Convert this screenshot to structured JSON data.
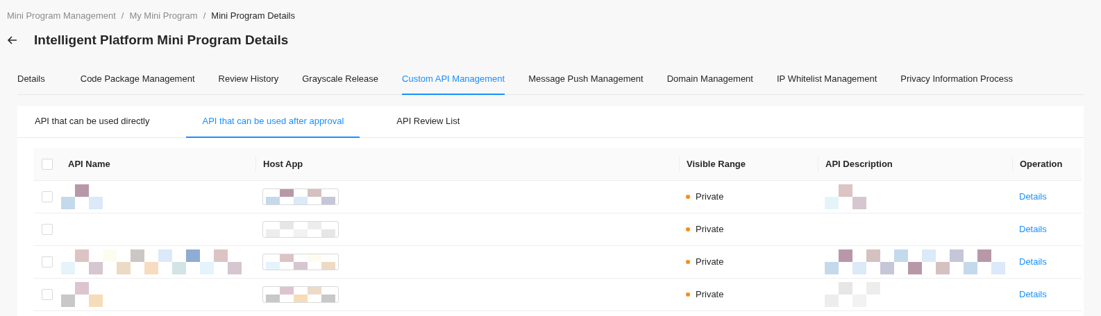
{
  "breadcrumb": [
    {
      "label": "Mini Program Management",
      "current": false
    },
    {
      "label": "My Mini Program",
      "current": false
    },
    {
      "label": "Mini Program Details",
      "current": true
    }
  ],
  "breadcrumb_separator": "/",
  "page_title": "Intelligent Platform Mini Program Details",
  "tabs": [
    {
      "label": "Details",
      "selected": false
    },
    {
      "label": "Code Package Management",
      "selected": false
    },
    {
      "label": "Review History",
      "selected": false
    },
    {
      "label": "Grayscale Release",
      "selected": false
    },
    {
      "label": "Custom API Management",
      "selected": true
    },
    {
      "label": "Message Push Management",
      "selected": false
    },
    {
      "label": "Domain Management",
      "selected": false
    },
    {
      "label": "IP Whitelist Management",
      "selected": false
    },
    {
      "label": "Privacy Information Process",
      "selected": false
    }
  ],
  "subtabs": [
    {
      "label": "API that can be used directly",
      "selected": false
    },
    {
      "label": "API that can be used after approval",
      "selected": true
    },
    {
      "label": "API Review List",
      "selected": false
    }
  ],
  "table": {
    "select_all_checked": false,
    "columns": [
      "API Name",
      "Host App",
      "Visible Range",
      "API Description",
      "Operation"
    ],
    "rows": [
      {
        "checked": false,
        "visible_range": "Private",
        "color": "#fa8c16",
        "operation": "Details"
      },
      {
        "checked": false,
        "visible_range": "Private",
        "color": "#fa8c16",
        "operation": "Details"
      },
      {
        "checked": false,
        "visible_range": "Private",
        "color": "#fa8c16",
        "operation": "Details"
      },
      {
        "checked": false,
        "visible_range": "Private",
        "color": "#fa8c16",
        "operation": "Details"
      }
    ]
  }
}
